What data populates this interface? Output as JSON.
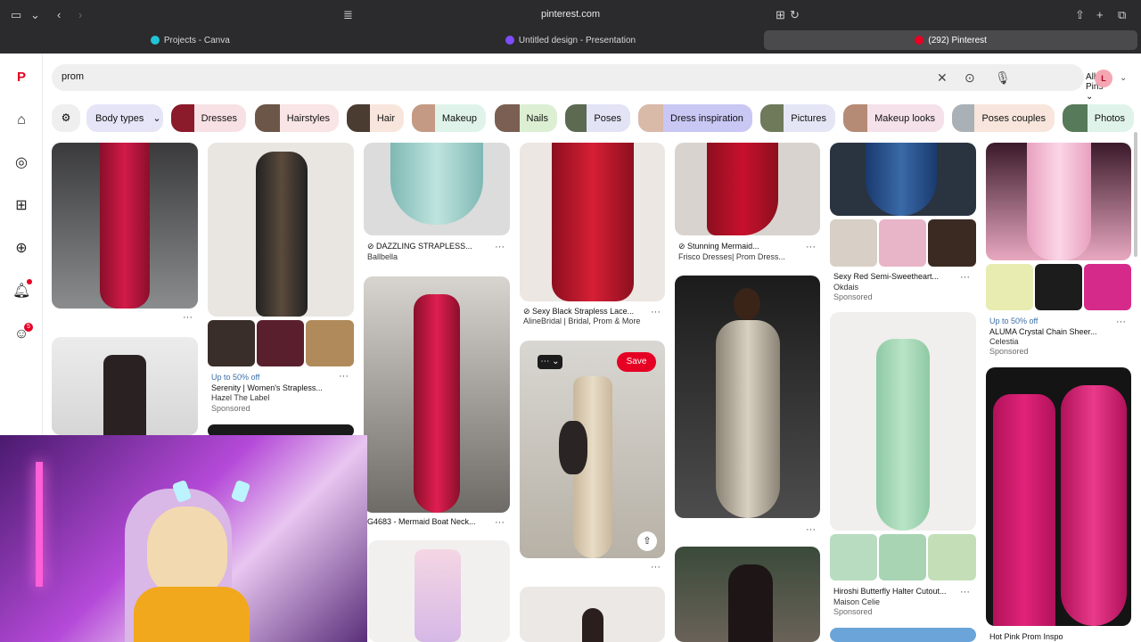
{
  "browser": {
    "url": "pinterest.com",
    "tabs": [
      {
        "label": "Projects - Canva",
        "active": false
      },
      {
        "label": "Untitled design - Presentation",
        "active": false
      },
      {
        "label": "(292) Pinterest",
        "active": true
      }
    ]
  },
  "search": {
    "query": "prom",
    "filter": "All Pins",
    "avatar_letter": "L"
  },
  "sidebar": {
    "notifications_badge": "5"
  },
  "chips": [
    {
      "label": "Body types",
      "color": "#e6e4f7"
    },
    {
      "label": "Dresses",
      "color": "#f7e1e4"
    },
    {
      "label": "Hairstyles",
      "color": "#f9e4e6"
    },
    {
      "label": "Hair",
      "color": "#f8e6dc"
    },
    {
      "label": "Makeup",
      "color": "#dff3ea"
    },
    {
      "label": "Nails",
      "color": "#dcefd3"
    },
    {
      "label": "Poses",
      "color": "#e2e3f5"
    },
    {
      "label": "Dress inspiration",
      "color": "#c9c7f4"
    },
    {
      "label": "Pictures",
      "color": "#e4e6f5"
    },
    {
      "label": "Makeup looks",
      "color": "#f5e1e9"
    },
    {
      "label": "Poses couples",
      "color": "#f8e6dc"
    },
    {
      "label": "Photos",
      "color": "#dff3ea"
    }
  ],
  "pins": {
    "p1": {
      "title": "DAZZLING STRAPLESS...",
      "sub": "Ballbella"
    },
    "p2": {
      "title": "Stunning Mermaid...",
      "sub": "Frisco Dresses| Prom Dress..."
    },
    "p3": {
      "title": "Sexy Red Semi-Sweetheart...",
      "sub": "Okdais",
      "sponsored": "Sponsored"
    },
    "p4": {
      "deal": "Up to 50% off",
      "title": "ALUMA Crystal Chain Sheer...",
      "sub": "Celestia",
      "sponsored": "Sponsored"
    },
    "p5": {
      "title": "Sexy Black Strapless Lace...",
      "sub": "AlineBridal | Bridal, Prom & More"
    },
    "p6": {
      "deal": "Up to 50% off",
      "title": "Serenity | Women's Strapless...",
      "sub": "Hazel The Label",
      "sponsored": "Sponsored"
    },
    "p7": {
      "title": "G4683 - Mermaid Boat Neck..."
    },
    "p8": {
      "title": "Hiroshi Butterfly Halter Cutout...",
      "sub": "Maison Celie",
      "sponsored": "Sponsored"
    },
    "p9": {
      "title": "Hot Pink Prom Inspo"
    },
    "save": "Save"
  }
}
